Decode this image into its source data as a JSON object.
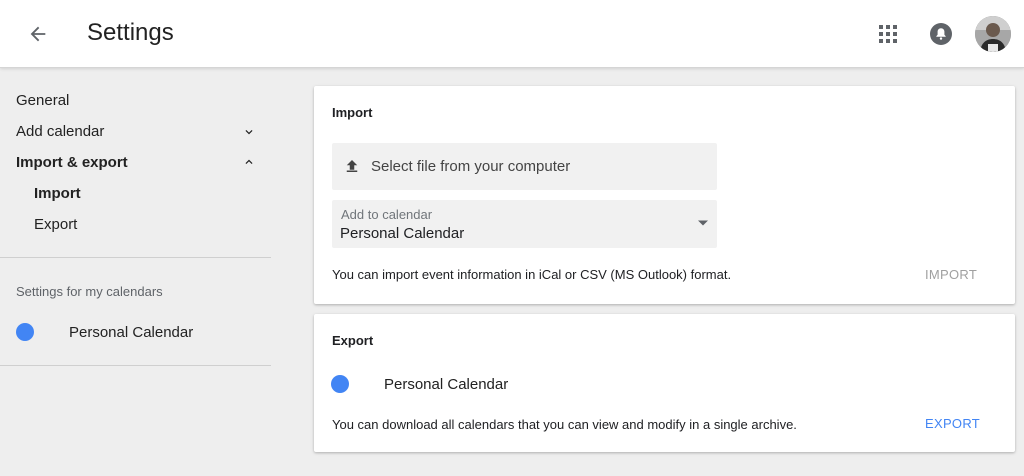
{
  "header": {
    "title": "Settings",
    "back_icon": "arrow-left-icon",
    "apps_icon": "apps-grid-icon",
    "notifications_icon": "bell-icon"
  },
  "sidebar": {
    "items": [
      {
        "label": "General"
      },
      {
        "label": "Add calendar",
        "expanded": false
      },
      {
        "label": "Import & export",
        "expanded": true,
        "active": true
      },
      {
        "label": "Import",
        "active": true
      },
      {
        "label": "Export"
      }
    ],
    "section_label": "Settings for my calendars",
    "calendars": [
      {
        "name": "Personal Calendar",
        "color": "#4285f4"
      }
    ]
  },
  "import_card": {
    "title": "Import",
    "file_button_label": "Select file from your computer",
    "select_label": "Add to calendar",
    "select_value": "Personal Calendar",
    "hint": "You can import event information in iCal or CSV (MS Outlook) format.",
    "import_button_label": "IMPORT"
  },
  "export_card": {
    "title": "Export",
    "calendar_name": "Personal Calendar",
    "calendar_color": "#4285f4",
    "hint": "You can download all calendars that you can view and modify in a single archive.",
    "export_button_label": "EXPORT"
  },
  "colors": {
    "accent": "#4285f4",
    "disabled_text": "#a0a0a0"
  }
}
